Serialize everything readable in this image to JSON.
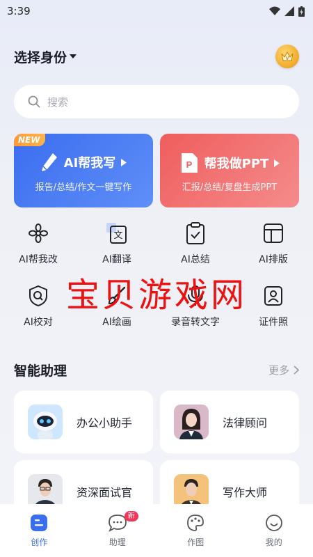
{
  "status_bar": {
    "time": "3:39"
  },
  "header": {
    "identity_label": "选择身份",
    "vip_icon": "crown-badge-icon"
  },
  "search": {
    "placeholder": "搜索"
  },
  "feature_cards": [
    {
      "badge": "NEW",
      "title": "AI帮我写",
      "subtitle": "报告/总结/作文一键写作",
      "color": "#3b6df0"
    },
    {
      "title": "帮我做PPT",
      "subtitle": "汇报/总结/复盘生成PPT",
      "color": "#ef5d5d"
    }
  ],
  "tools": [
    {
      "label": "AI帮我改",
      "icon": "flower-edit-icon"
    },
    {
      "label": "AI翻译",
      "icon": "translate-icon"
    },
    {
      "label": "AI总结",
      "icon": "clipboard-check-icon"
    },
    {
      "label": "AI排版",
      "icon": "layout-icon"
    },
    {
      "label": "AI校对",
      "icon": "shield-check-icon"
    },
    {
      "label": "AI绘画",
      "icon": "brush-icon"
    },
    {
      "label": "录音转文字",
      "icon": "microphone-icon"
    },
    {
      "label": "证件照",
      "icon": "id-photo-icon"
    }
  ],
  "watermark": "宝贝游戏网",
  "assistants_section": {
    "title": "智能助理",
    "more": "更多"
  },
  "assistants": [
    {
      "name": "办公小助手",
      "avatar": "robot-avatar"
    },
    {
      "name": "法律顾问",
      "avatar": "lawyer-avatar"
    },
    {
      "name": "资深面试官",
      "avatar": "interviewer-avatar"
    },
    {
      "name": "写作大师",
      "avatar": "writer-avatar"
    }
  ],
  "tabbar": [
    {
      "label": "创作",
      "icon": "create-icon",
      "active": true
    },
    {
      "label": "助理",
      "icon": "chat-icon",
      "badge": "新"
    },
    {
      "label": "作图",
      "icon": "palette-icon"
    },
    {
      "label": "我的",
      "icon": "smile-icon"
    }
  ],
  "colors": {
    "accent": "#3a6ef0",
    "ppt_red": "#ef5d5d",
    "badge_red": "#f2375b"
  }
}
